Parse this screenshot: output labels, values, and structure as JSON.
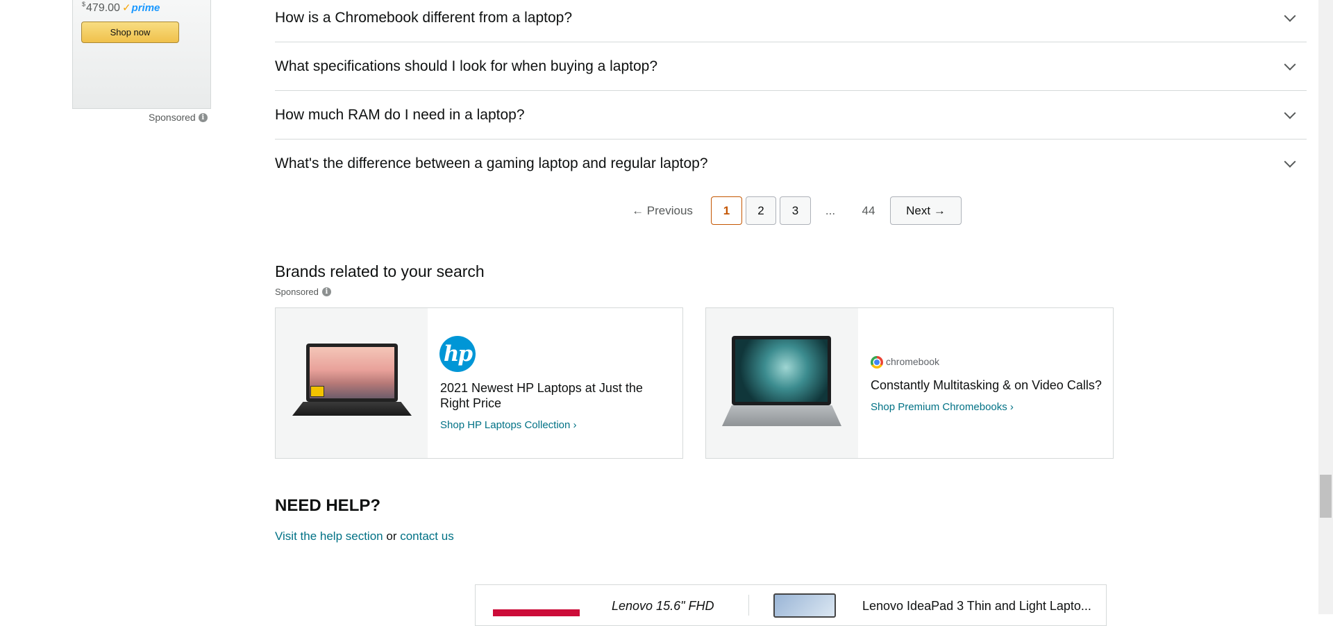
{
  "ad": {
    "currency": "$",
    "price": "479.00",
    "prime_label": "prime",
    "shop_button": "Shop now",
    "sponsored": "Sponsored"
  },
  "faq": [
    {
      "question": "How is a Chromebook different from a laptop?"
    },
    {
      "question": "What specifications should I look for when buying a laptop?"
    },
    {
      "question": "How much RAM do I need in a laptop?"
    },
    {
      "question": "What's the difference between a gaming laptop and regular laptop?"
    }
  ],
  "pagination": {
    "previous": "← Previous",
    "current": "1",
    "pages": [
      "2",
      "3"
    ],
    "ellipsis": "...",
    "last": "44",
    "next": "Next →"
  },
  "brands": {
    "heading": "Brands related to your search",
    "sponsored": "Sponsored",
    "cards": [
      {
        "logo": "hp",
        "title": "2021 Newest HP Laptops at Just the Right Price",
        "link": "Shop HP Laptops Collection ›"
      },
      {
        "logo": "chromebook",
        "title": "Constantly Multitasking & on Video Calls?",
        "link": "Shop Premium Chromebooks ›"
      }
    ]
  },
  "help": {
    "heading": "NEED HELP?",
    "link1": "Visit the help section",
    "connector": "or",
    "link2": "contact us"
  },
  "bottom": {
    "item1": "Lenovo 15.6\" FHD",
    "item2": "Lenovo IdeaPad 3 Thin and Light Lapto..."
  },
  "colors": {
    "link": "#007185",
    "current_page": "#c45500",
    "prime": "#1a98ff",
    "hp_blue": "#0096d6"
  }
}
